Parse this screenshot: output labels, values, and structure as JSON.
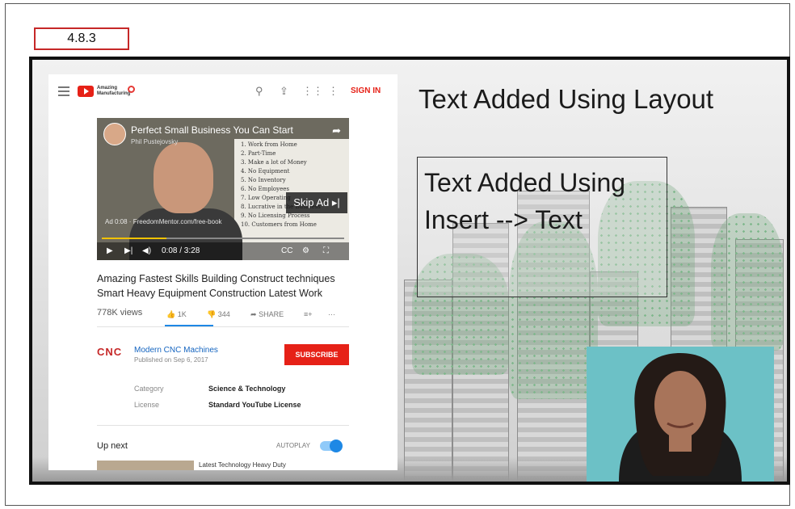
{
  "slide_label": "4.8.3",
  "slide": {
    "heading": "Text Added Using Layout",
    "textbox_line1": "Text Added Using",
    "textbox_line2": "Insert --> Text"
  },
  "youtube": {
    "brand": "Amazing Manufacturing",
    "signin": "SIGN IN",
    "video": {
      "title": "Perfect Small Business You Can Start",
      "author": "Phil Pustejovsky",
      "url": "Ad 0:08 · FreedomMentor.com/free-book",
      "skip_ad": "Skip Ad ▸|",
      "time": "0:08 / 3:28",
      "whiteboard": "1. Work from Home\n2. Part-Time\n3. Make a lot of Money\n4. No Equipment\n5. No Inventory\n6. No Employees\n7. Low Operating\n8. Lucrative in the Business\n9. No Licensing Process\n10. Customers from Home"
    },
    "video_title_line1": "Amazing Fastest Skills Building Construct techniques",
    "video_title_line2": "Smart Heavy Equipment Construction Latest Work",
    "views": "778K views",
    "likes": "1K",
    "dislikes": "344",
    "share": "SHARE",
    "channel_logo": "CNC",
    "channel_name": "Modern CNC Machines",
    "published": "Published on Sep 6, 2017",
    "subscribe": "SUBSCRIBE",
    "category_label": "Category",
    "category_value": "Science & Technology",
    "license_label": "License",
    "license_value": "Standard YouTube License",
    "up_next": "Up next",
    "autoplay": "AUTOPLAY",
    "next_title": "Latest Technology Heavy Duty"
  },
  "colors": {
    "accent_red": "#e62117",
    "link_blue": "#1565c0",
    "frame_red": "#c62828"
  }
}
